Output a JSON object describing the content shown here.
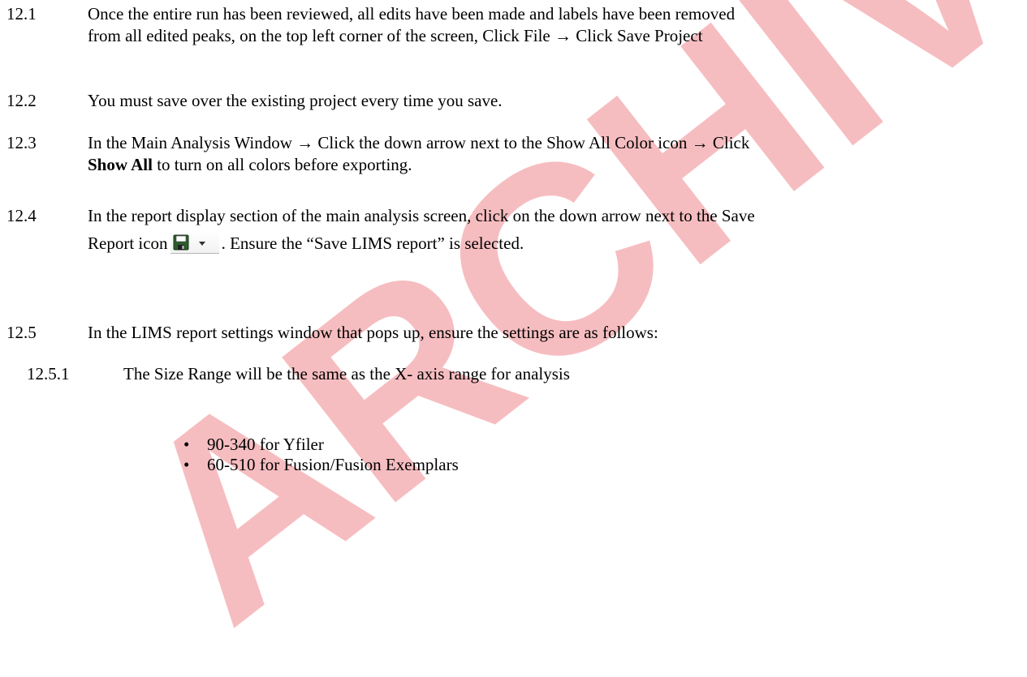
{
  "watermark": {
    "text": "ARCHIVE",
    "color": "#f4a7ab"
  },
  "steps": [
    {
      "number": "12.1",
      "line1": "Once the entire run has been reviewed, all edits have been made and labels have been removed",
      "line2": "from all edited peaks, on the top left corner of the screen, Click File → Click Save Project"
    },
    {
      "number": "12.2",
      "line1": "You must save over the existing project every time you save."
    },
    {
      "number": "12.3",
      "line1": "In the Main Analysis Window → Click the down arrow next to the Show All Color icon → Click",
      "line2_bold": "Show All",
      "line2_rest": " to turn on all colors before exporting."
    },
    {
      "number": "12.4",
      "line1": "In the report display section of the main analysis screen, click on the down arrow next to the Save",
      "line2_before": "Report icon",
      "line2_after": ". Ensure the “Save LIMS report” is selected.",
      "icon": "save-report-dropdown-icon"
    },
    {
      "number": "12.5",
      "line1": "In the LIMS report settings window that pops up, ensure the settings are as follows:"
    }
  ],
  "substep": {
    "number": "12.5.1",
    "text": "The Size Range will be the same as the X- axis range for analysis"
  },
  "bullets": [
    "90-340 for Yfiler",
    "60-510 for Fusion/Fusion Exemplars"
  ]
}
